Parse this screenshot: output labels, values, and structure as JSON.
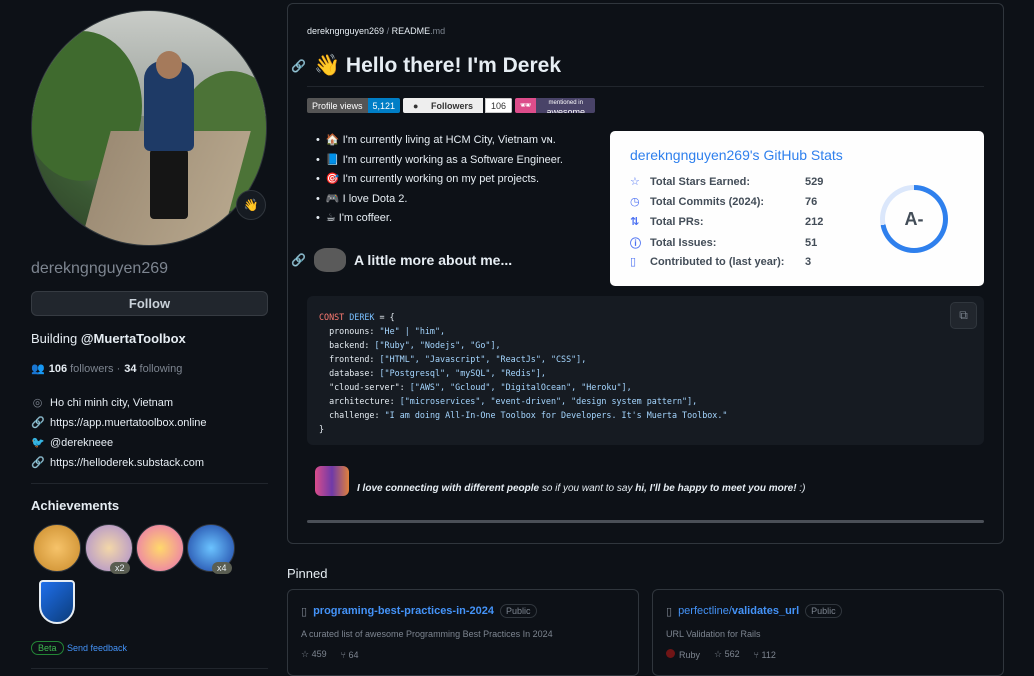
{
  "profile": {
    "username": "derekngnguyen269",
    "status_emoji": "👋",
    "follow_label": "Follow",
    "bio_prefix": "Building ",
    "bio_org": "@MuertaToolbox",
    "followers_count": "106",
    "followers_label": " followers · ",
    "following_count": "34",
    "following_label": " following",
    "location": "Ho chi minh city, Vietnam",
    "website": "https://app.muertatoolbox.online",
    "twitter": "@derekneee",
    "blog": "https://helloderek.substack.com"
  },
  "achievements": {
    "title": "Achievements",
    "badges": [
      {
        "name": "cowboy"
      },
      {
        "name": "pull-shark",
        "count": "x2"
      },
      {
        "name": "yolo"
      },
      {
        "name": "starstruck",
        "count": "x4"
      }
    ],
    "beta_label": "Beta",
    "feedback_label": "Send feedback"
  },
  "readme": {
    "owner": "derekngnguyen269",
    "sep": " / ",
    "file": "README",
    "ext": ".md",
    "heading": "👋 Hello there! I'm Derek",
    "shields": {
      "views_label": "Profile views",
      "views_value": "5,121",
      "followers_label": "Followers",
      "followers_value": "106",
      "awesome_top": "mentioned in",
      "awesome_bottom": "awesome"
    },
    "bullets": [
      "🏠 I'm currently living at HCM City, Vietnam ᴠɴ.",
      "📘 I'm currently working as a Software Engineer.",
      "🎯 I'm currently working on my pet projects.",
      "🎮 I love Dota 2.",
      "☕ I'm coffeer."
    ],
    "more_heading": "A little more about me...",
    "quote_em": "I love connecting with different people",
    "quote_mid": " so if you want to say ",
    "quote_hi": "hi, I'll be happy to meet you more!",
    "quote_end": " :)"
  },
  "code": {
    "line1a": "CONST",
    "line1b": " DEREK",
    "line1c": " = {",
    "pronouns_k": "  pronouns: ",
    "pronouns_v": "\"He\" | \"him\",",
    "backend_k": "  backend: ",
    "backend_v": "[\"Ruby\", \"Nodejs\", \"Go\"],",
    "frontend_k": "  frontend: ",
    "frontend_v": "[\"HTML\", \"Javascript\", \"ReactJs\", \"CSS\"],",
    "database_k": "  database: ",
    "database_v": "[\"Postgresql\", \"mySQL\", \"Redis\"],",
    "cloud_k": "  \"cloud-server\": ",
    "cloud_v": "[\"AWS\", \"Gcloud\", \"DigitalOcean\", \"Heroku\"],",
    "arch_k": "  architecture: ",
    "arch_v": "[\"microservices\", \"event-driven\", \"design system pattern\"],",
    "chal_k": "  challenge: ",
    "chal_v": "\"I am doing All-In-One Toolbox for Developers. It's Muerta Toolbox.\"",
    "close": "}"
  },
  "stats": {
    "title": "derekngnguyen269's GitHub Stats",
    "rows": [
      {
        "label": "Total Stars Earned:",
        "value": "529",
        "icon": "star-icon"
      },
      {
        "label": "Total Commits (2024):",
        "value": "76",
        "icon": "clock-icon"
      },
      {
        "label": "Total PRs:",
        "value": "212",
        "icon": "pull-request-icon"
      },
      {
        "label": "Total Issues:",
        "value": "51",
        "icon": "issue-icon"
      },
      {
        "label": "Contributed to (last year):",
        "value": "3",
        "icon": "repo-icon"
      }
    ],
    "grade": "A-",
    "grade_progress": 0.72,
    "colors": {
      "title": "#2f80ed",
      "ring": "#2f80ed"
    }
  },
  "pinned": {
    "title": "Pinned",
    "repos": [
      {
        "name": "programing-best-practices-in-2024",
        "visibility": "Public",
        "description": "A curated list of awesome Programming Best Practices In 2024",
        "stars": "459",
        "forks": "64"
      },
      {
        "name_owner": "perfectline/",
        "name_repo": "validates_url",
        "visibility": "Public",
        "description": "URL Validation for Rails",
        "language": "Ruby",
        "language_color": "#701516",
        "stars": "562",
        "forks": "112"
      }
    ]
  }
}
